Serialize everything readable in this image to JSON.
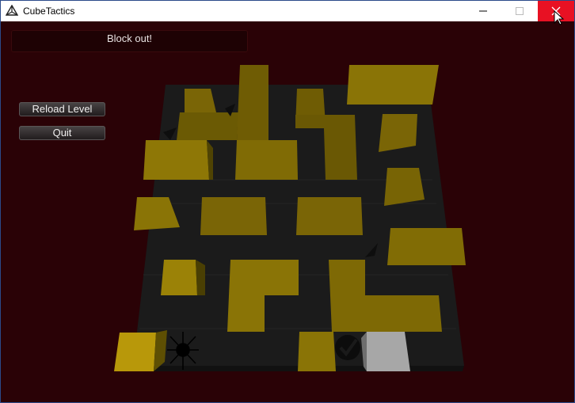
{
  "window": {
    "title": "CubeTactics"
  },
  "hud": {
    "message": "Block out!"
  },
  "menu": {
    "reload_label": "Reload Level",
    "quit_label": "Quit"
  },
  "colors": {
    "background": "#2a0206",
    "board": "#1b1b1b",
    "wall_top": "#b8980a",
    "wall_side": "#6b5a04",
    "player": "#a7a7a7",
    "close_button": "#e81123"
  },
  "icons": [
    "unity-logo-icon",
    "minimize-icon",
    "maximize-icon",
    "close-icon",
    "mouse-cursor-icon",
    "spark-marker-icon",
    "checkmark-goal-icon",
    "arrow-marker-icon"
  ]
}
